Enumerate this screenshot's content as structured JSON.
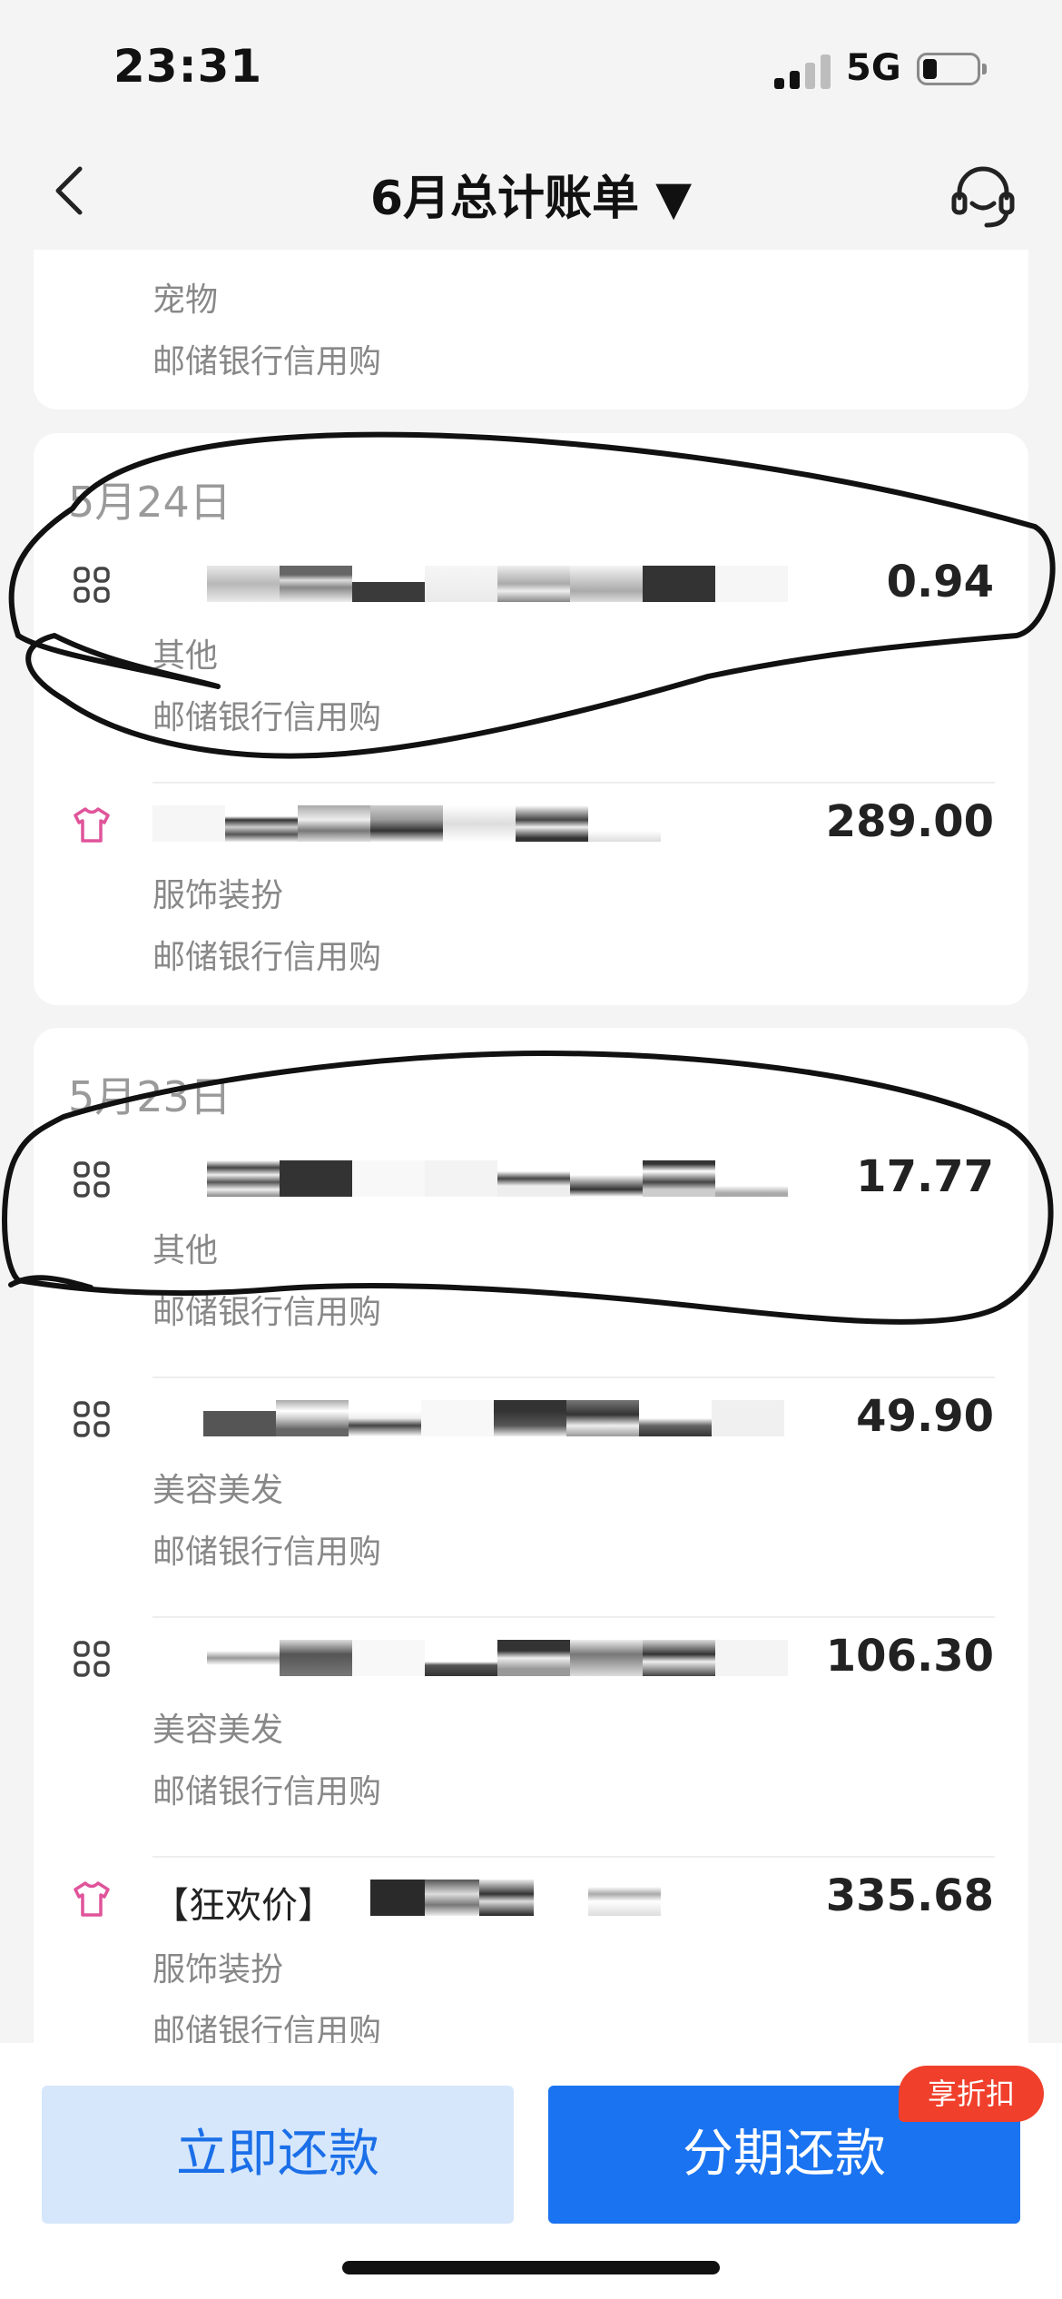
{
  "status_bar": {
    "time": "23:31",
    "network": "5G"
  },
  "nav": {
    "title": "6月总计账单 ▼"
  },
  "top_card": {
    "category": "宠物",
    "source": "邮储银行信用购"
  },
  "groups": [
    {
      "date": "5月24日",
      "items": [
        {
          "icon": "grid-icon",
          "amount": "0.94",
          "category": "其他",
          "source": "邮储银行信用购"
        },
        {
          "icon": "clothing-icon",
          "amount": "289.00",
          "category": "服饰装扮",
          "source": "邮储银行信用购"
        }
      ]
    },
    {
      "date": "5月23日",
      "items": [
        {
          "icon": "grid-icon",
          "amount": "17.77",
          "category": "其他",
          "source": "邮储银行信用购"
        },
        {
          "icon": "grid-icon",
          "amount": "49.90",
          "category": "美容美发",
          "source": "邮储银行信用购"
        },
        {
          "icon": "grid-icon",
          "amount": "106.30",
          "category": "美容美发",
          "source": "邮储银行信用购"
        },
        {
          "icon": "clothing-icon",
          "name": "【狂欢价】",
          "amount": "335.68",
          "category": "服饰装扮",
          "source": "邮储银行信用购"
        }
      ]
    }
  ],
  "bottom_bar": {
    "pay_now_label": "立即还款",
    "installment_label": "分期还款",
    "discount_badge": "享折扣"
  },
  "colors": {
    "primary": "#1a73f0",
    "primary_light": "#d6e7fb",
    "badge": "#f0402c",
    "clothing_icon": "#e0549a"
  }
}
